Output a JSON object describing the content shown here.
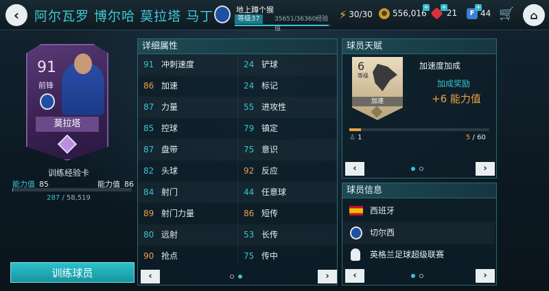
{
  "header": {
    "back_icon": "chevron-left-icon",
    "title": "阿尔瓦罗 博尔哈 莫拉塔 马丁",
    "user": {
      "name": "地上蹲个猴",
      "level": "等级37",
      "xp": "35651/36360经验值",
      "xp_progress": 0.98
    },
    "stamina": "30/30",
    "coins": "556,016",
    "gems": "21",
    "fifa_points": "44",
    "home_icon": "home-icon",
    "cart_icon": "cart-icon"
  },
  "player_card": {
    "rating": "91",
    "position": "前锋",
    "name": "莫拉塔",
    "club": "Chelsea"
  },
  "training": {
    "card_label": "训练经验卡",
    "ovr_label_left": "能力值",
    "ovr_left": "85",
    "ovr_label_right": "能力值",
    "ovr_right": "86",
    "exp_current": "287",
    "exp_total": " / 58,519",
    "exp_progress": 0.005,
    "button": "训练球员"
  },
  "attributes": {
    "title": "详细属性",
    "left": [
      {
        "value": "91",
        "name": "冲刺速度",
        "color": "teal"
      },
      {
        "value": "86",
        "name": "加速",
        "color": "orange"
      },
      {
        "value": "87",
        "name": "力量",
        "color": "teal"
      },
      {
        "value": "85",
        "name": "控球",
        "color": "teal"
      },
      {
        "value": "87",
        "name": "盘带",
        "color": "teal"
      },
      {
        "value": "82",
        "name": "头球",
        "color": "teal"
      },
      {
        "value": "84",
        "name": "射门",
        "color": "teal"
      },
      {
        "value": "89",
        "name": "射门力量",
        "color": "orange"
      },
      {
        "value": "80",
        "name": "远射",
        "color": "teal"
      },
      {
        "value": "90",
        "name": "抢点",
        "color": "orange"
      }
    ],
    "right": [
      {
        "value": "24",
        "name": "铲球",
        "color": "teal"
      },
      {
        "value": "24",
        "name": "标记",
        "color": "teal"
      },
      {
        "value": "55",
        "name": "进攻性",
        "color": "teal"
      },
      {
        "value": "79",
        "name": "镇定",
        "color": "teal"
      },
      {
        "value": "75",
        "name": "意识",
        "color": "teal"
      },
      {
        "value": "92",
        "name": "反应",
        "color": "orange"
      },
      {
        "value": "44",
        "name": "任意球",
        "color": "teal"
      },
      {
        "value": "86",
        "name": "短传",
        "color": "orange"
      },
      {
        "value": "53",
        "name": "长传",
        "color": "teal"
      },
      {
        "value": "75",
        "name": "传中",
        "color": "teal"
      }
    ],
    "prev": "‹",
    "next": "›"
  },
  "talent": {
    "title": "球员天赋",
    "level": "6",
    "level_unit": "等级",
    "skill_name": "加速",
    "skill_title": "加速度加成",
    "bonus_label": "加成奖励",
    "bonus_value": "+6 能力值",
    "min": "1",
    "progress_current": "5",
    "progress_total": " / 60",
    "progress": 0.083,
    "prev": "‹",
    "next": "›"
  },
  "player_info": {
    "title": "球员信息",
    "nation": "西班牙",
    "club": "切尔西",
    "league": "英格兰足球超级联赛",
    "prev": "‹",
    "next": "›"
  },
  "colors": {
    "teal": "#36c5d2",
    "orange": "#f0a045",
    "card_purple": "#3a2152"
  }
}
